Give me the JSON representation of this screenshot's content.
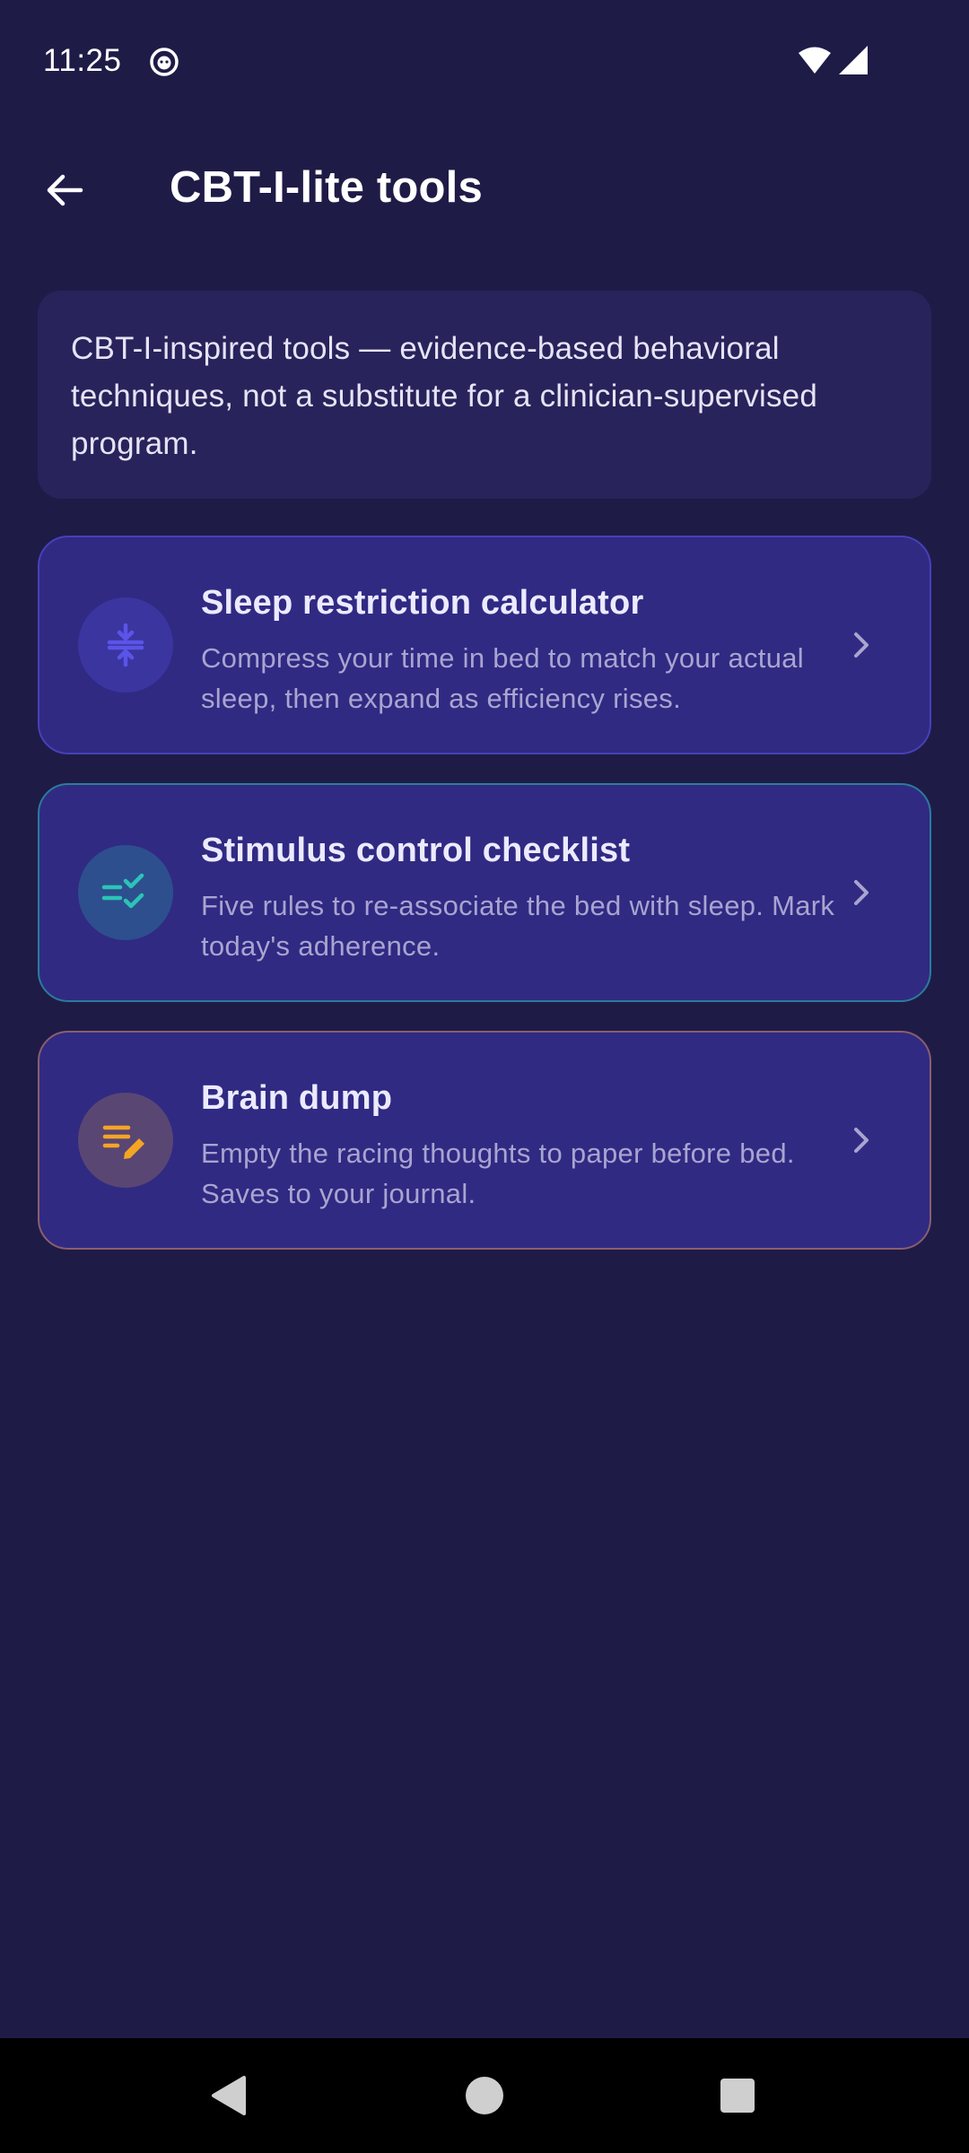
{
  "status_bar": {
    "time": "11:25",
    "icons": [
      "app-notification-icon",
      "wifi-icon",
      "cell-signal-icon"
    ]
  },
  "app_bar": {
    "title": "CBT-I-lite tools",
    "back_icon": "arrow-back-icon"
  },
  "disclaimer": {
    "text": "CBT-I-inspired tools — evidence-based behavioral techniques, not a substitute for a clinician-supervised program."
  },
  "tools": [
    {
      "title": "Sleep restriction calculator",
      "description": "Compress your time in bed to match your actual sleep, then expand as efficiency rises.",
      "icon": "compress-icon",
      "accent": "#5b54e8"
    },
    {
      "title": "Stimulus control checklist",
      "description": "Five rules to re-associate the bed with sleep. Mark today's adherence.",
      "icon": "checklist-icon",
      "accent": "#2bc4b6"
    },
    {
      "title": "Brain dump",
      "description": "Empty the racing thoughts to paper before bed. Saves to your journal.",
      "icon": "edit-note-icon",
      "accent": "#f5a524"
    }
  ],
  "colors": {
    "background": "#1f1b47",
    "card": "#302a83",
    "disclaimer_bg": "#28235a"
  },
  "nav_bar": {
    "icons": [
      "nav-back-icon",
      "nav-home-icon",
      "nav-recents-icon"
    ]
  }
}
